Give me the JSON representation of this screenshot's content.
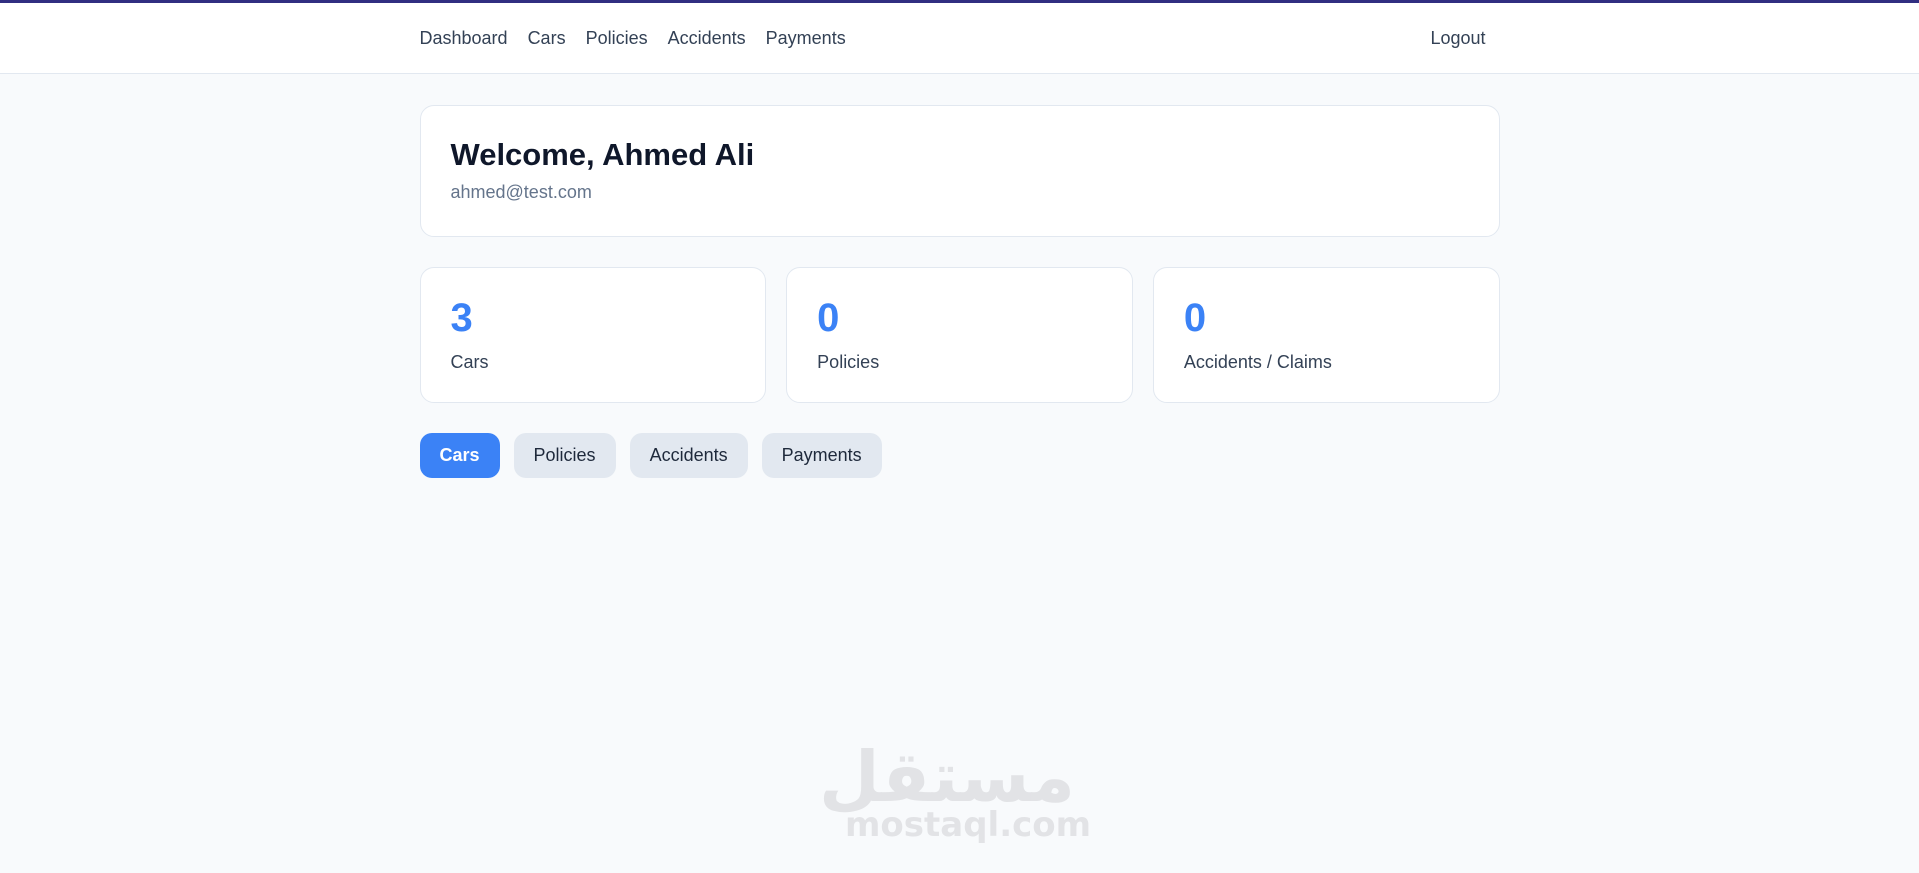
{
  "nav": {
    "links": [
      "Dashboard",
      "Cars",
      "Policies",
      "Accidents",
      "Payments"
    ],
    "logout": "Logout"
  },
  "welcome": {
    "title": "Welcome, Ahmed Ali",
    "email": "ahmed@test.com"
  },
  "stats": [
    {
      "value": "3",
      "label": "Cars"
    },
    {
      "value": "0",
      "label": "Policies"
    },
    {
      "value": "0",
      "label": "Accidents / Claims"
    }
  ],
  "tabs": [
    {
      "label": "Cars",
      "active": true
    },
    {
      "label": "Policies",
      "active": false
    },
    {
      "label": "Accidents",
      "active": false
    },
    {
      "label": "Payments",
      "active": false
    }
  ],
  "watermark": {
    "arabic": "مستقل",
    "latin": "mostaql.com"
  },
  "colors": {
    "accent": "#3b82f6",
    "top_bar": "#312e81",
    "background": "#f8fafc"
  }
}
